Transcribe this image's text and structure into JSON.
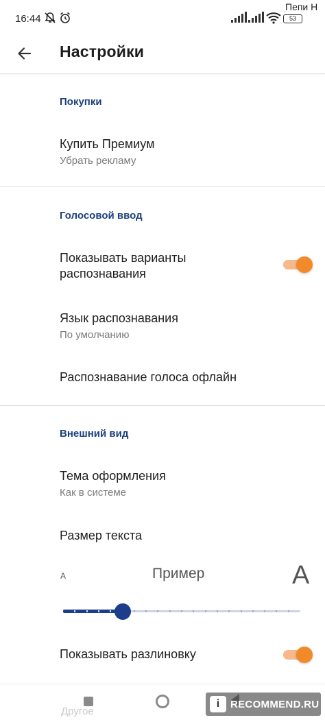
{
  "status_bar": {
    "time": "16:44",
    "carrier": "Пепи Н",
    "battery": "53"
  },
  "toolbar": {
    "title": "Настройки"
  },
  "sections": {
    "purchases": {
      "header": "Покупки",
      "premium": {
        "title": "Купить Премиум",
        "subtitle": "Убрать рекламу"
      }
    },
    "voice": {
      "header": "Голосовой ввод",
      "show_variants": {
        "title_line1": "Показывать варианты",
        "title_line2": "распознавания",
        "enabled": true
      },
      "language": {
        "title": "Язык распознавания",
        "subtitle": "По умолчанию"
      },
      "offline": {
        "title": "Распознавание голоса офлайн"
      }
    },
    "appearance": {
      "header": "Внешний вид",
      "theme": {
        "title": "Тема оформления",
        "subtitle": "Как в системе"
      },
      "text_size": {
        "title": "Размер текста",
        "small_label": "A",
        "example_label": "Пример",
        "large_label": "A",
        "steps": 20,
        "value_fraction": 0.25
      },
      "show_lines": {
        "title": "Показывать разлиновку",
        "enabled": true
      }
    }
  },
  "bottom_nav": {
    "other_label": "Другое"
  },
  "watermark": {
    "text": "RECOMMEND.RU"
  },
  "colors": {
    "accent": "#f28a2a",
    "section_header": "#1b3f7a",
    "slider": "#1c3e8a"
  }
}
